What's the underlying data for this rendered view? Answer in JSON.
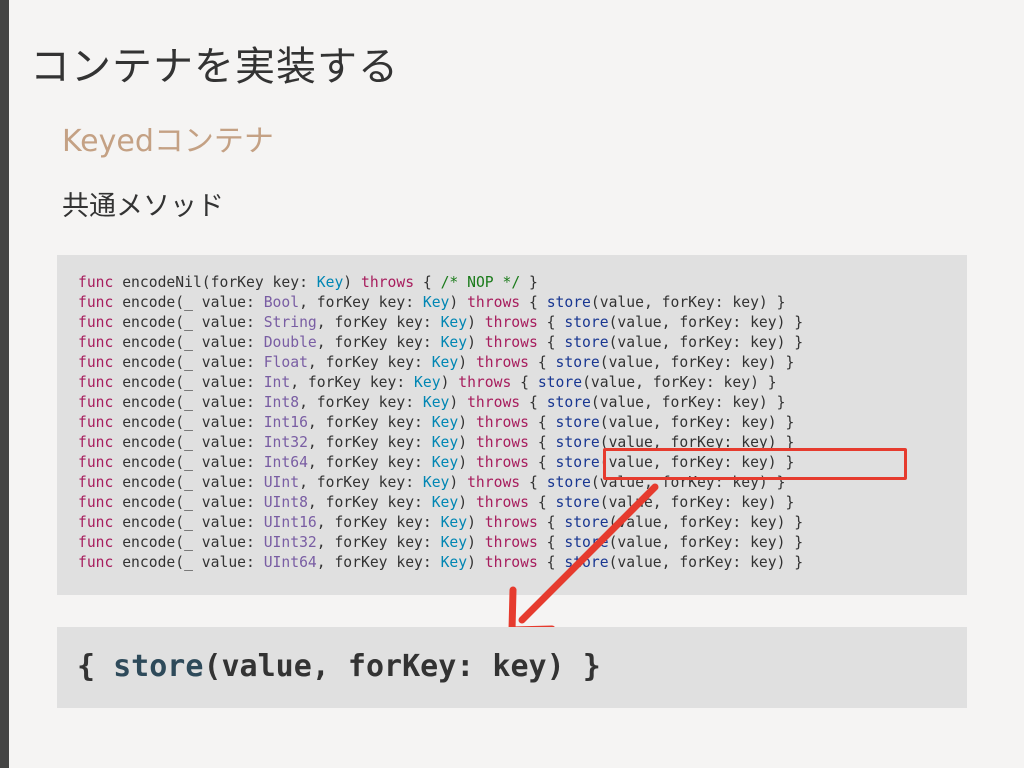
{
  "slide": {
    "title": "コンテナを実装する",
    "subtitle": "Keyedコンテナ",
    "heading": "共通メソッド"
  },
  "code": {
    "line0": {
      "func": "func",
      "name": " encodeNil(forKey key: ",
      "key_type": "Key",
      "close": ") ",
      "throws": "throws",
      "body_open": " { ",
      "comment": "/* NOP */",
      "body_close": " }"
    },
    "lines": [
      {
        "type": "Bool"
      },
      {
        "type": "String"
      },
      {
        "type": "Double"
      },
      {
        "type": "Float"
      },
      {
        "type": "Int"
      },
      {
        "type": "Int8"
      },
      {
        "type": "Int16"
      },
      {
        "type": "Int32"
      },
      {
        "type": "Int64"
      },
      {
        "type": "UInt"
      },
      {
        "type": "UInt8"
      },
      {
        "type": "UInt16"
      },
      {
        "type": "UInt32"
      },
      {
        "type": "UInt64"
      }
    ],
    "parts": {
      "func": "func",
      "encode": " encode(_ value: ",
      "forkey": ", forKey key: ",
      "key_type": "Key",
      "close": ") ",
      "throws": "throws",
      "body_open": " { ",
      "store": "store",
      "store_args": "(value, forKey: key) }"
    }
  },
  "zoom": {
    "open": "{ ",
    "store": "store",
    "rest": "(value, forKey: key) }"
  },
  "annotation": {
    "highlight_color": "#e63b2e"
  }
}
